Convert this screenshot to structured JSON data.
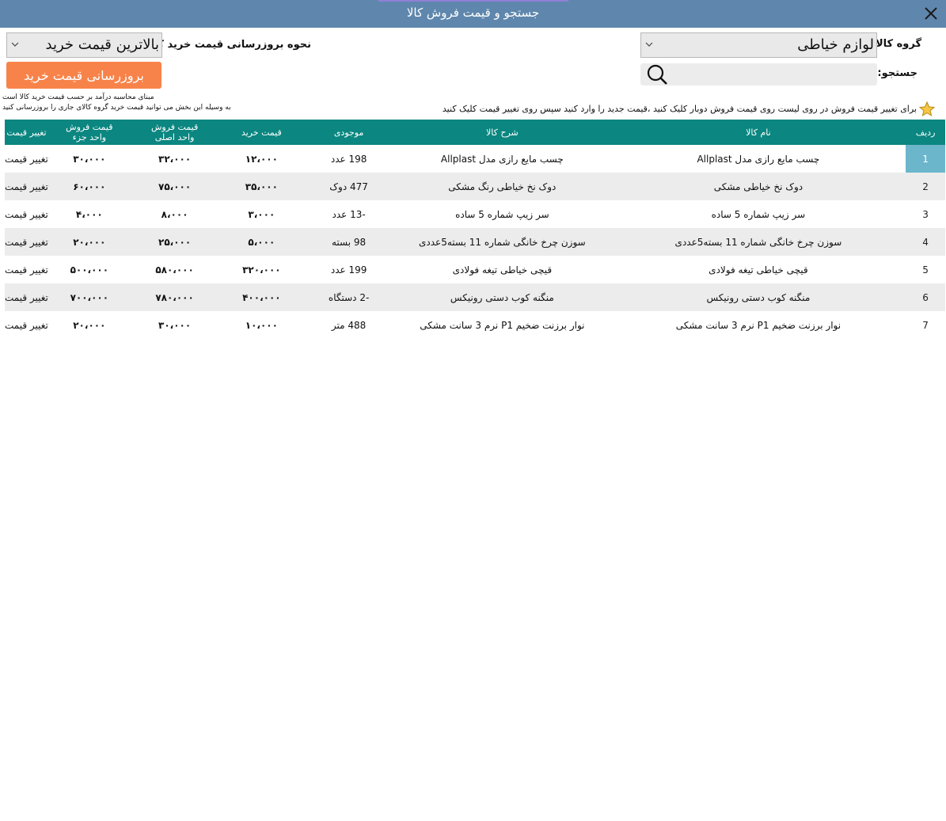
{
  "window": {
    "title": "جستجو و قیمت فروش کالا"
  },
  "filters": {
    "group_label": "گروه کالا:",
    "group_value": "لوازم خیاطی",
    "update_method_label": "نحوه بروزرسانی قیمت خرید کالا :",
    "update_method_value": "بالاترین قیمت خرید",
    "search_label": "جستجو:",
    "search_value": "",
    "update_button": "بروزرسانی قیمت خرید",
    "note_line1": "مبنای محاسبه درآمد بر حسب قیمت خرید کالا است",
    "note_line2": "به وسیله این بخش می توانید قیمت خرید گروه کالای جاری را بروزرسانی کنید",
    "hint": "برای تغییر قیمت فروش در روی لیست روی قیمت فروش دوبار کلیک کنید ،قیمت جدید را وارد کنید سپس روی تغییر قیمت کلیک کنید"
  },
  "table": {
    "headers": {
      "row": "ردیف",
      "name": "نام کالا",
      "desc": "شرح کالا",
      "stock": "موجودی",
      "buy": "قیمت خرید",
      "sell_main_1": "قیمت فروش",
      "sell_main_2": "واحد اصلی",
      "sell_part_1": "قیمت فروش",
      "sell_part_2": "واحد جزء",
      "change": "تغییر قیمت"
    },
    "rows": [
      {
        "idx": "1",
        "name": "چسب مایع رازی مدل Allplast",
        "desc": "چسب مایع رازی مدل Allplast",
        "stock": "198 عدد",
        "buy": "۱۲،۰۰۰",
        "sell_main": "۳۲،۰۰۰",
        "sell_part": "۳۰،۰۰۰",
        "action": "تغییر قیمت"
      },
      {
        "idx": "2",
        "name": "دوک نخ خیاطی مشکی",
        "desc": "دوک نخ خیاطی رنگ مشکی",
        "stock": "477 دوک",
        "buy": "۳۵،۰۰۰",
        "sell_main": "۷۵،۰۰۰",
        "sell_part": "۶۰،۰۰۰",
        "action": "تغییر قیمت"
      },
      {
        "idx": "3",
        "name": "سر زیپ شماره 5 ساده",
        "desc": "سر زیپ شماره 5 ساده",
        "stock": "-13 عدد",
        "buy": "۳،۰۰۰",
        "sell_main": "۸،۰۰۰",
        "sell_part": "۴،۰۰۰",
        "action": "تغییر قیمت"
      },
      {
        "idx": "4",
        "name": "سوزن چرخ خانگی شماره 11 بسته5عددی",
        "desc": "سوزن چرخ خانگی شماره 11 بسته5عددی",
        "stock": "98 بسته",
        "buy": "۵،۰۰۰",
        "sell_main": "۲۵،۰۰۰",
        "sell_part": "۲۰،۰۰۰",
        "action": "تغییر قیمت"
      },
      {
        "idx": "5",
        "name": "قیچی خیاطی تیغه فولادی",
        "desc": "قیچی خیاطی تیغه فولادی",
        "stock": "199 عدد",
        "buy": "۳۲۰،۰۰۰",
        "sell_main": "۵۸۰،۰۰۰",
        "sell_part": "۵۰۰،۰۰۰",
        "action": "تغییر قیمت"
      },
      {
        "idx": "6",
        "name": "منگنه کوب دستی رونیکس",
        "desc": "منگنه کوب دستی رونیکس",
        "stock": "-2 دستگاه",
        "buy": "۴۰۰،۰۰۰",
        "sell_main": "۷۸۰،۰۰۰",
        "sell_part": "۷۰۰،۰۰۰",
        "action": "تغییر قیمت"
      },
      {
        "idx": "7",
        "name": "نوار برزنت ضخیم P1 نرم 3 سانت مشکی",
        "desc": "نوار برزنت ضخیم P1 نرم 3 سانت مشکی",
        "stock": "488 متر",
        "buy": "۱۰،۰۰۰",
        "sell_main": "۳۰،۰۰۰",
        "sell_part": "۲۰،۰۰۰",
        "action": "تغییر قیمت"
      }
    ]
  },
  "colors": {
    "titlebar": "#5f87ad",
    "table_header": "#0b8680",
    "selected_index": "#6cb6cc",
    "update_button": "#f8834a"
  },
  "icons": [
    "close-icon",
    "search-icon",
    "star-icon",
    "chevron-down-icon"
  ]
}
